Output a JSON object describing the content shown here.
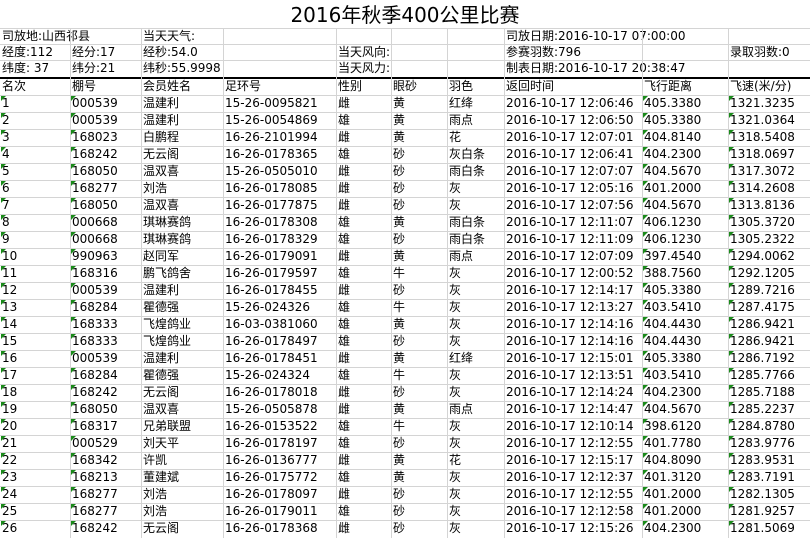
{
  "title": "2016年秋季400公里比赛",
  "info": {
    "r1": {
      "location": "司放地:山西祁县",
      "weather": "当天天气:",
      "release_date": "司放日期:2016-10-17 07:00:00"
    },
    "r2": {
      "lng_deg": "经度:112",
      "lng_min": "经分:17",
      "lng_sec": "经秒:54.0",
      "wind_dir": "当天风向:",
      "entries": "参赛羽数:796",
      "accepted": "录取羽数:0"
    },
    "r3": {
      "lat_deg": "纬度: 37",
      "lat_min": "纬分:21",
      "lat_sec": "纬秒:55.9998",
      "wind_force": "当天风力:",
      "created": "制表日期:2016-10-17 20:38:47"
    }
  },
  "columns": [
    "名次",
    "棚号",
    "会员姓名",
    "足环号",
    "性别",
    "眼砂",
    "羽色",
    "返回时间",
    "飞行距离",
    "飞速(米/分)"
  ],
  "rows": [
    [
      "1",
      "000539",
      "温建利",
      "15-26-0095821",
      "雌",
      "黄",
      "红绛",
      "2016-10-17 12:06:46",
      "405.3380",
      "1321.3235"
    ],
    [
      "2",
      "000539",
      "温建利",
      "15-26-0054869",
      "雄",
      "黄",
      "雨点",
      "2016-10-17 12:06:50",
      "405.3380",
      "1321.0364"
    ],
    [
      "3",
      "168023",
      "白鹏程",
      "16-26-2101994",
      "雌",
      "黄",
      "花",
      "2016-10-17 12:07:01",
      "404.8140",
      "1318.5408"
    ],
    [
      "4",
      "168242",
      "无云阁",
      "16-26-0178365",
      "雄",
      "砂",
      "灰白条",
      "2016-10-17 12:06:41",
      "404.2300",
      "1318.0697"
    ],
    [
      "5",
      "168050",
      "温双喜",
      "15-26-0505010",
      "雌",
      "砂",
      "雨白条",
      "2016-10-17 12:07:07",
      "404.5670",
      "1317.3072"
    ],
    [
      "6",
      "168277",
      "刘浩",
      "16-26-0178085",
      "雌",
      "砂",
      "灰",
      "2016-10-17 12:05:16",
      "401.2000",
      "1314.2608"
    ],
    [
      "7",
      "168050",
      "温双喜",
      "16-26-0177875",
      "雌",
      "砂",
      "灰",
      "2016-10-17 12:07:56",
      "404.5670",
      "1313.8136"
    ],
    [
      "8",
      "000668",
      "琪琳赛鸽",
      "16-26-0178308",
      "雄",
      "黄",
      "雨白条",
      "2016-10-17 12:11:07",
      "406.1230",
      "1305.3720"
    ],
    [
      "9",
      "000668",
      "琪琳赛鸽",
      "16-26-0178329",
      "雄",
      "砂",
      "雨白条",
      "2016-10-17 12:11:09",
      "406.1230",
      "1305.2322"
    ],
    [
      "10",
      "990963",
      "赵同军",
      "16-26-0179091",
      "雌",
      "黄",
      "雨点",
      "2016-10-17 12:07:09",
      "397.4540",
      "1294.0062"
    ],
    [
      "11",
      "168316",
      "鹏飞鸽舍",
      "16-26-0179597",
      "雄",
      "牛",
      "灰",
      "2016-10-17 12:00:52",
      "388.7560",
      "1292.1205"
    ],
    [
      "12",
      "000539",
      "温建利",
      "16-26-0178455",
      "雌",
      "砂",
      "灰",
      "2016-10-17 12:14:17",
      "405.3380",
      "1289.7216"
    ],
    [
      "13",
      "168284",
      "瞿德强",
      "15-26-024326",
      "雄",
      "牛",
      "灰",
      "2016-10-17 12:13:27",
      "403.5410",
      "1287.4175"
    ],
    [
      "14",
      "168333",
      "飞煌鸽业",
      "16-03-0381060",
      "雄",
      "黄",
      "灰",
      "2016-10-17 12:14:16",
      "404.4430",
      "1286.9421"
    ],
    [
      "15",
      "168333",
      "飞煌鸽业",
      "16-26-0178497",
      "雄",
      "砂",
      "灰",
      "2016-10-17 12:14:16",
      "404.4430",
      "1286.9421"
    ],
    [
      "16",
      "000539",
      "温建利",
      "16-26-0178451",
      "雌",
      "黄",
      "红绛",
      "2016-10-17 12:15:01",
      "405.3380",
      "1286.7192"
    ],
    [
      "17",
      "168284",
      "瞿德强",
      "15-26-024324",
      "雄",
      "牛",
      "灰",
      "2016-10-17 12:13:51",
      "403.5410",
      "1285.7766"
    ],
    [
      "18",
      "168242",
      "无云阁",
      "16-26-0178018",
      "雌",
      "砂",
      "灰",
      "2016-10-17 12:14:24",
      "404.2300",
      "1285.7188"
    ],
    [
      "19",
      "168050",
      "温双喜",
      "15-26-0505878",
      "雌",
      "黄",
      "雨点",
      "2016-10-17 12:14:47",
      "404.5670",
      "1285.2237"
    ],
    [
      "20",
      "168317",
      "兄弟联盟",
      "16-26-0153522",
      "雄",
      "牛",
      "灰",
      "2016-10-17 12:10:14",
      "398.6120",
      "1284.8780"
    ],
    [
      "21",
      "000529",
      "刘天平",
      "16-26-0178197",
      "雄",
      "砂",
      "灰",
      "2016-10-17 12:12:55",
      "401.7780",
      "1283.9776"
    ],
    [
      "22",
      "168342",
      "许凯",
      "16-26-0136777",
      "雌",
      "黄",
      "花",
      "2016-10-17 12:15:17",
      "404.8090",
      "1283.9531"
    ],
    [
      "23",
      "168213",
      "董建斌",
      "16-26-0175772",
      "雄",
      "黄",
      "灰",
      "2016-10-17 12:12:37",
      "401.3120",
      "1283.7191"
    ],
    [
      "24",
      "168277",
      "刘浩",
      "16-26-0178097",
      "雌",
      "砂",
      "灰",
      "2016-10-17 12:12:55",
      "401.2000",
      "1282.1305"
    ],
    [
      "25",
      "168277",
      "刘浩",
      "16-26-0179011",
      "雄",
      "砂",
      "灰",
      "2016-10-17 12:12:58",
      "401.2000",
      "1281.9257"
    ],
    [
      "26",
      "168242",
      "无云阁",
      "16-26-0178368",
      "雌",
      "砂",
      "灰",
      "2016-10-17 12:15:26",
      "404.2300",
      "1281.5069"
    ]
  ],
  "colors": {
    "grid": "#d4d4d4",
    "marker": "#1a8a1a"
  }
}
